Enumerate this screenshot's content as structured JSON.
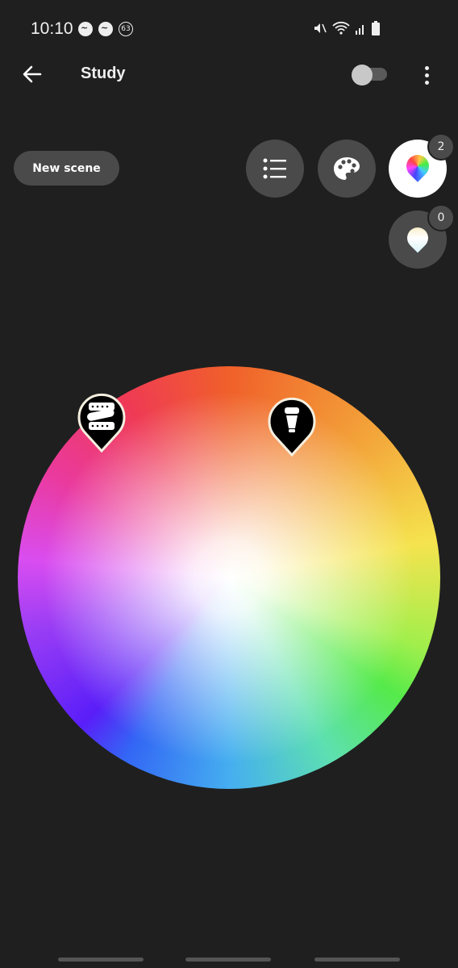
{
  "status_bar": {
    "time": "10:10",
    "notification_count": "63",
    "icons": [
      "messenger-icon",
      "messenger-icon",
      "mute-icon",
      "wifi-icon",
      "signal-icon",
      "battery-icon"
    ]
  },
  "app_bar": {
    "title": "Study",
    "back_icon": "arrow-left-icon",
    "toggle_on": false,
    "more_icon": "more-vert-icon"
  },
  "actions": {
    "new_scene_label": "New scene",
    "buttons": [
      {
        "name": "list-view",
        "icon": "list-icon"
      },
      {
        "name": "scene-palette",
        "icon": "palette-icon"
      },
      {
        "name": "color-picker",
        "icon": "color-drop-icon",
        "badge": "2",
        "selected": true
      },
      {
        "name": "white-picker",
        "icon": "white-drop-icon",
        "badge": "0",
        "selected": false
      }
    ]
  },
  "color_wheel": {
    "lights": [
      {
        "name": "lightstrip",
        "icon": "lightstrip-icon"
      },
      {
        "name": "bulb",
        "icon": "bulb-icon"
      }
    ]
  }
}
